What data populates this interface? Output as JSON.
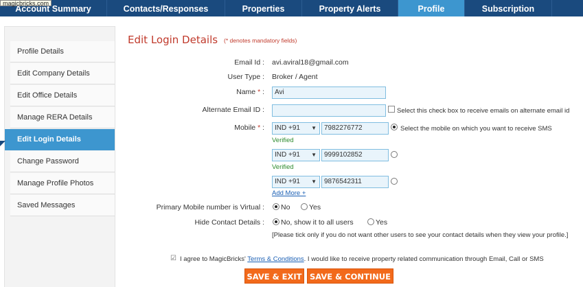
{
  "tooltip": "magicbricks.com",
  "topnav": {
    "tabs": [
      "Account Summary",
      "Contacts/Responses",
      "Properties",
      "Property Alerts",
      "Profile",
      "Subscription"
    ],
    "active": "Profile"
  },
  "sidebar": {
    "items": [
      "Profile Details",
      "Edit Company Details",
      "Edit Office Details",
      "Manage RERA Details",
      "Edit Login Details",
      "Change Password",
      "Manage Profile Photos",
      "Saved Messages"
    ],
    "active": "Edit Login Details"
  },
  "form": {
    "title": "Edit Login Details",
    "mandatory_note": "(* denotes mandatory fields)",
    "email_label": "Email Id :",
    "email_value": "avi.aviral18@gmail.com",
    "usertype_label": "User Type :",
    "usertype_value": "Broker / Agent",
    "name_label": "Name",
    "name_value": "Avi",
    "alt_email_label": "Alternate Email ID :",
    "alt_email_value": "",
    "alt_email_hint": "Select this check box to receive emails on alternate email id",
    "mobile_label": "Mobile",
    "mobile_hint": "Select the mobile on which you want to receive SMS",
    "mobiles": [
      {
        "code": "IND +91",
        "number": "7982276772",
        "status": "Verified"
      },
      {
        "code": "IND +91",
        "number": "9999102852",
        "status": "Verified"
      },
      {
        "code": "IND +91",
        "number": "9876542311",
        "status": ""
      }
    ],
    "add_more": "Add More +",
    "virtual_label": "Primary Mobile number is Virtual :",
    "virtual_no": "No",
    "virtual_yes": "Yes",
    "hide_label": "Hide Contact Details :",
    "hide_no": "No, show it to all users",
    "hide_yes": "Yes",
    "hide_note": "[Please tick only if you do not want other users to see your contact details when they view your profile.]",
    "agree_prefix": "I agree to MagicBricks'",
    "agree_link": "Terms & Conditions",
    "agree_suffix": ". I would like to receive property related communication through Email, Call or SMS",
    "save_exit": "SAVE & EXIT",
    "save_continue": "SAVE & CONTINUE"
  }
}
